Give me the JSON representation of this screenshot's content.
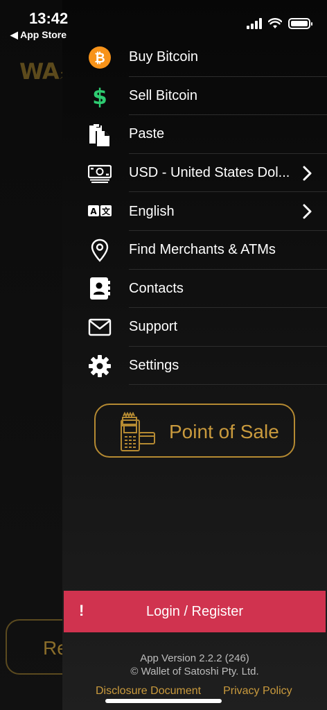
{
  "status_bar": {
    "time": "13:42",
    "back_label": "◀ App Store"
  },
  "background": {
    "logo_text": "WA",
    "button_label": "Re"
  },
  "menu": {
    "items": [
      {
        "label": "Buy Bitcoin",
        "icon": "bitcoin-icon",
        "chevron": false
      },
      {
        "label": "Sell Bitcoin",
        "icon": "dollar-icon",
        "chevron": false
      },
      {
        "label": "Paste",
        "icon": "clipboard-icon",
        "chevron": false
      },
      {
        "label": "USD - United States Dol...",
        "icon": "banknote-icon",
        "chevron": true
      },
      {
        "label": "English",
        "icon": "translate-icon",
        "chevron": true
      },
      {
        "label": "Find Merchants & ATMs",
        "icon": "location-pin-icon",
        "chevron": false
      },
      {
        "label": "Contacts",
        "icon": "contacts-icon",
        "chevron": false
      },
      {
        "label": "Support",
        "icon": "mail-icon",
        "chevron": false
      },
      {
        "label": "Settings",
        "icon": "gear-icon",
        "chevron": false
      }
    ]
  },
  "point_of_sale": {
    "label": "Point of Sale",
    "icon": "pos-terminal-icon"
  },
  "login": {
    "alert": "!",
    "label": "Login / Register"
  },
  "footer": {
    "version": "App Version 2.2.2 (246)",
    "copyright": "© Wallet of Satoshi Pty. Ltd.",
    "disclosure": "Disclosure Document",
    "privacy": "Privacy Policy"
  },
  "colors": {
    "accent": "#c99a3d",
    "bitcoin": "#f7931a",
    "dollar": "#2ecc71",
    "login_bar": "#d0334f"
  }
}
